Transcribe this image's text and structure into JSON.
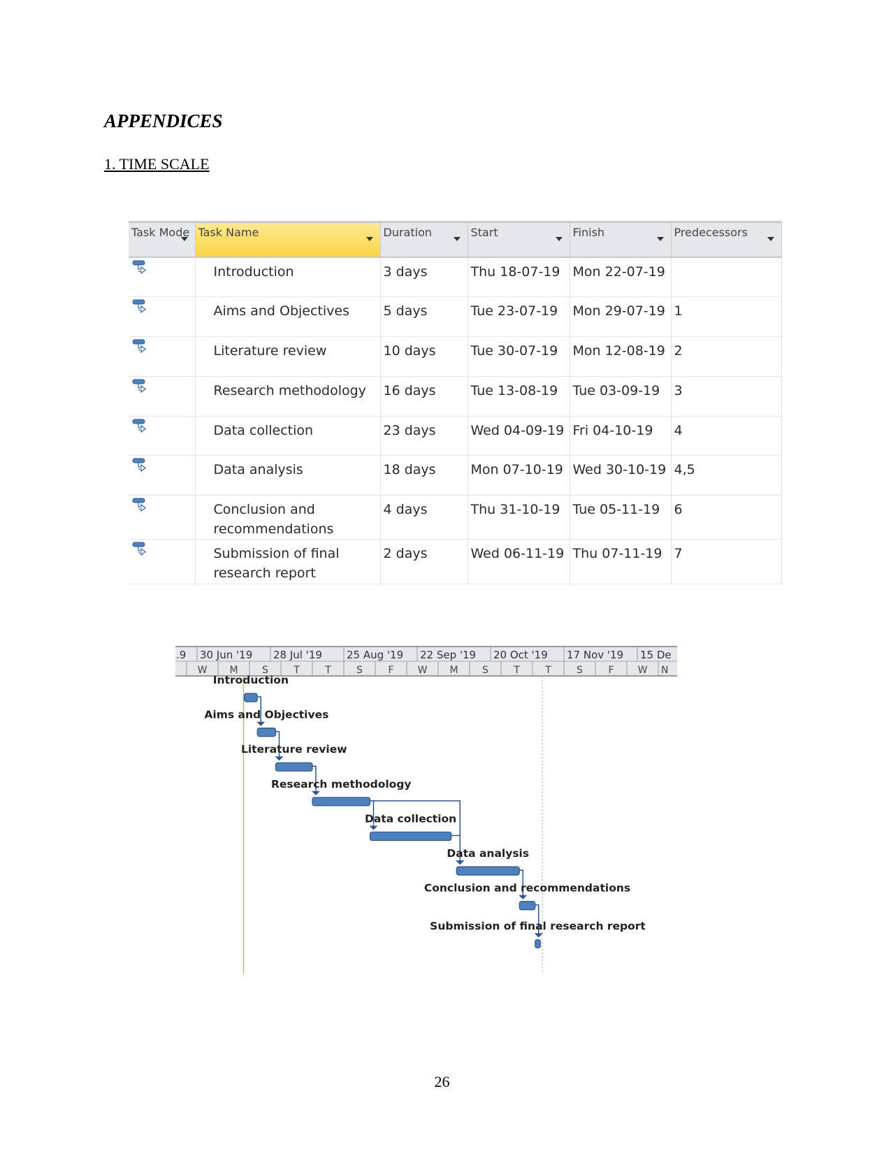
{
  "heading": "APPENDICES",
  "section_title": "1. TIME SCALE",
  "table": {
    "columns": [
      "Task Mode",
      "Task Name",
      "Duration",
      "Start",
      "Finish",
      "Predecessors"
    ],
    "rows": [
      {
        "mode_icon": "auto-scheduled-task-icon",
        "name": "Introduction",
        "duration": "3 days",
        "start": "Thu 18-07-19",
        "finish": "Mon 22-07-19",
        "predecessors": ""
      },
      {
        "mode_icon": "auto-scheduled-task-icon",
        "name": "Aims and Objectives",
        "duration": "5 days",
        "start": "Tue 23-07-19",
        "finish": "Mon 29-07-19",
        "predecessors": "1"
      },
      {
        "mode_icon": "auto-scheduled-task-icon",
        "name": "Literature review",
        "duration": "10 days",
        "start": "Tue 30-07-19",
        "finish": "Mon 12-08-19",
        "predecessors": "2"
      },
      {
        "mode_icon": "auto-scheduled-task-icon",
        "name": "Research methodology",
        "duration": "16 days",
        "start": "Tue 13-08-19",
        "finish": "Tue 03-09-19",
        "predecessors": "3"
      },
      {
        "mode_icon": "auto-scheduled-task-icon",
        "name": "Data collection",
        "duration": "23 days",
        "start": "Wed 04-09-19",
        "finish": "Fri 04-10-19",
        "predecessors": "4"
      },
      {
        "mode_icon": "auto-scheduled-task-icon",
        "name": "Data analysis",
        "duration": "18 days",
        "start": "Mon 07-10-19",
        "finish": "Wed 30-10-19",
        "predecessors": "4,5"
      },
      {
        "mode_icon": "auto-scheduled-task-icon",
        "name": "Conclusion and recommendations",
        "duration": "4 days",
        "start": "Thu 31-10-19",
        "finish": "Tue 05-11-19",
        "predecessors": "6"
      },
      {
        "mode_icon": "auto-scheduled-task-icon",
        "name": "Submission of final research report",
        "duration": "2 days",
        "start": "Wed 06-11-19",
        "finish": "Thu 07-11-19",
        "predecessors": "7"
      }
    ]
  },
  "gantt": {
    "top_tier": [
      ".9",
      "30 Jun '19",
      "28 Jul '19",
      "25 Aug '19",
      "22 Sep '19",
      "20 Oct '19",
      "17 Nov '19",
      "15 De"
    ],
    "bottom_tier": [
      "",
      "W",
      "M",
      "S",
      "T",
      "T",
      "S",
      "F",
      "W",
      "M",
      "S",
      "T",
      "T",
      "S",
      "F",
      "W",
      "N"
    ],
    "bar_labels": [
      "Introduction",
      "Aims and Objectives",
      "Literature review",
      "Research methodology",
      "Data collection",
      "Data analysis",
      "Conclusion and recommendations",
      "Submission of final research report"
    ],
    "colors": {
      "bar": "#4f81bd",
      "bar_border": "#2c5593",
      "today_line": "#f4a460",
      "header_bg": "#e4e7ec"
    }
  },
  "page_number": "26"
}
